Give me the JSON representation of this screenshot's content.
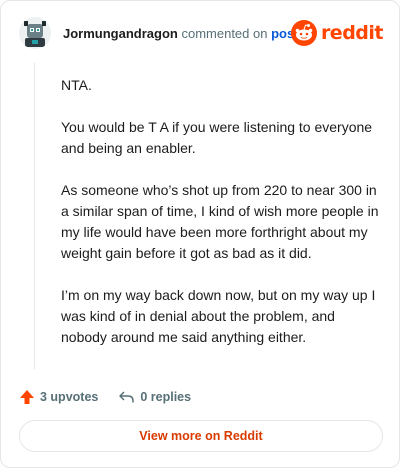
{
  "header": {
    "username": "Jormungandragon",
    "action_text": "commented on",
    "post_link": "post",
    "logo_text": "reddit",
    "logo_color": "#ff4500"
  },
  "comment": {
    "paragraphs": [
      "NTA.",
      "You would be T A if you were listening to everyone and being an enabler.",
      "As someone who’s shot up from 220 to near 300 in a similar span of time, I kind of wish more people in my life would have been more forthright about my weight gain before it got as bad as it did.",
      "I’m on my way back down now, but on my way up I was kind of in denial about the problem, and nobody around me said anything either."
    ]
  },
  "actions": {
    "upvotes": "3 upvotes",
    "replies": "0 replies",
    "upvote_icon": "upvote-arrow-icon",
    "reply_icon": "reply-arrow-icon"
  },
  "footer": {
    "view_more": "View more on Reddit"
  },
  "colors": {
    "brand": "#ff4500",
    "link": "#0a5ad8",
    "muted": "#576f76",
    "cta": "#d93a00"
  }
}
